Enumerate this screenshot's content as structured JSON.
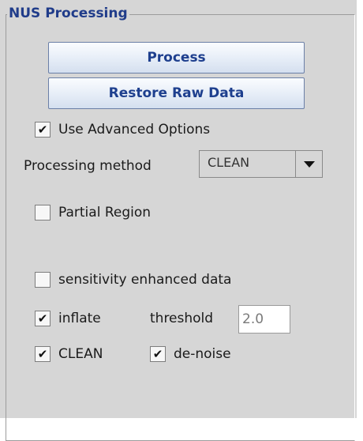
{
  "panel": {
    "title": "NUS Processing"
  },
  "buttons": {
    "process": "Process",
    "restore": "Restore Raw Data"
  },
  "advanced": {
    "label": "Use Advanced Options",
    "checked": true
  },
  "method": {
    "label": "Processing method",
    "value": "CLEAN"
  },
  "partial_region": {
    "label": "Partial Region",
    "checked": false
  },
  "sensitivity": {
    "label": "sensitivity enhanced data",
    "checked": false
  },
  "inflate": {
    "label": "inflate",
    "checked": true
  },
  "threshold": {
    "label": "threshold",
    "value": "2.0"
  },
  "clean": {
    "label": "CLEAN",
    "checked": true
  },
  "denoise": {
    "label": "de-noise",
    "checked": true
  },
  "check_glyph": "✔"
}
